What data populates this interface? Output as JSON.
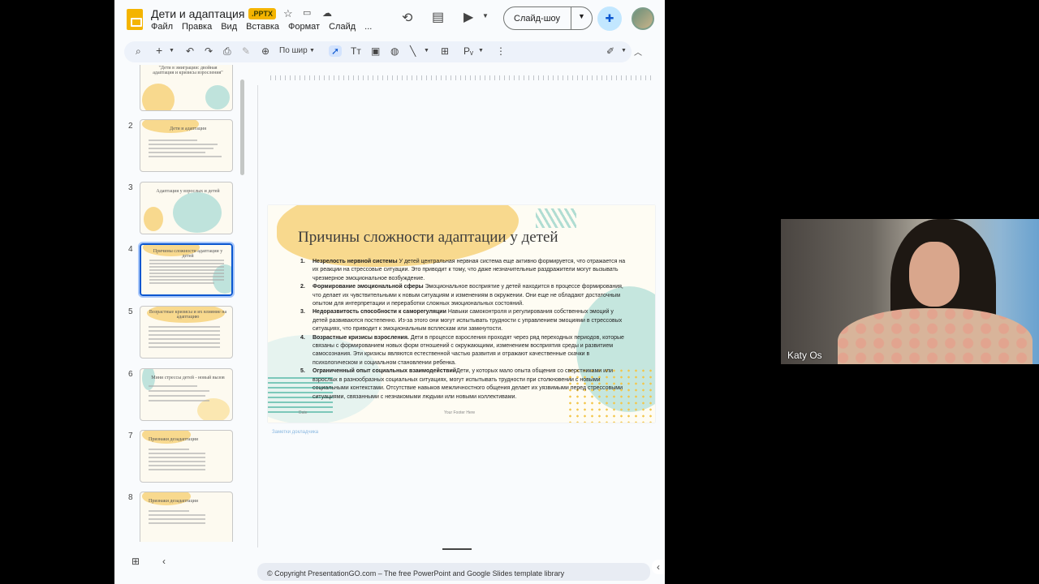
{
  "header": {
    "title": "Дети и адаптация",
    "format_badge": ".PPTX",
    "menu": [
      "Файл",
      "Правка",
      "Вид",
      "Вставка",
      "Формат",
      "Слайд",
      "..."
    ],
    "slideshow_label": "Слайд-шоу"
  },
  "toolbar": {
    "zoom_label": "По шир"
  },
  "filmstrip": {
    "slides": [
      {
        "number": "",
        "title": "\"Дети в эмиграции: двойная адаптация и кризисы взросления\""
      },
      {
        "number": "2",
        "title": "Дети и адаптация"
      },
      {
        "number": "3",
        "title": "Адаптация у взрослых и детей"
      },
      {
        "number": "4",
        "title": "Причины сложности адаптации у детей"
      },
      {
        "number": "5",
        "title": "Возрастные кризисы и их влияние на адаптацию"
      },
      {
        "number": "6",
        "title": "Мини стрессы детей - новый вызов"
      },
      {
        "number": "7",
        "title": "Признаки дезадаптации"
      },
      {
        "number": "8",
        "title": "Признаки дезадаптации"
      }
    ],
    "active_index": 3
  },
  "slide": {
    "title": "Причины сложности адаптации у детей",
    "items": [
      {
        "n": "1.",
        "bold": "Незрелость нервной системы",
        "text": " У детей центральная нервная система еще активно формируется, что отражается на их реакции на стрессовые ситуации. Это приводит к тому, что даже незначительные раздражители могут вызывать чрезмерное эмоциональное возбуждение."
      },
      {
        "n": "2.",
        "bold": "Формирование эмоциональной сферы",
        "text": " Эмоциональное восприятие у детей находится в процессе формирования, что делает их чувствительными к новым ситуациям и изменениям в окружении. Они еще не обладают достаточным опытом для интерпретации и переработки сложных эмоциональных состояний."
      },
      {
        "n": "3.",
        "bold": "Недоразвитость способности к саморегуляции",
        "text": " Навыки самоконтроля и регулирования собственных эмоций у детей развиваются постепенно. Из-за этого они могут испытывать трудности с управлением эмоциями в стрессовых ситуациях, что приводит к эмоциональным всплескам или замкнутости."
      },
      {
        "n": "4.",
        "bold": "Возрастные кризисы взросления.",
        "text": " Дети в процессе взросления проходят через ряд переходных периодов, которые связаны с формированием новых форм отношений с окружающими, изменением восприятия среды и развитием самосознания. Эти кризисы являются естественной частью развития и отражают качественные скачки в психологическом и социальном становлении ребенка."
      },
      {
        "n": "5.",
        "bold": "Ограниченный опыт социальных взаимодействий",
        "text": "Дети, у которых мало опыта общения со сверстниками или взрослых в разнообразных социальных ситуациях, могут испытывать трудности при столкновении с новыми социальными контекстами. Отсутствие навыков межличностного общения делает их уязвимыми перед стрессовыми ситуациями, связанными с незнакомыми людьми или новыми коллективами."
      }
    ],
    "footer": "Your Footer Here",
    "date": "Date"
  },
  "notes_hint": "Заметки докладчика",
  "copyright": "© Copyright PresentationGO.com – The free PowerPoint and Google Slides template library",
  "webcam": {
    "participant_name": "Katy Os"
  },
  "colors": {
    "accent_blue": "#0b57d0",
    "slides_yellow": "#f4b400",
    "slide_yellow_blob": "#f8d98e",
    "slide_teal_blob": "#bfe3dc"
  }
}
